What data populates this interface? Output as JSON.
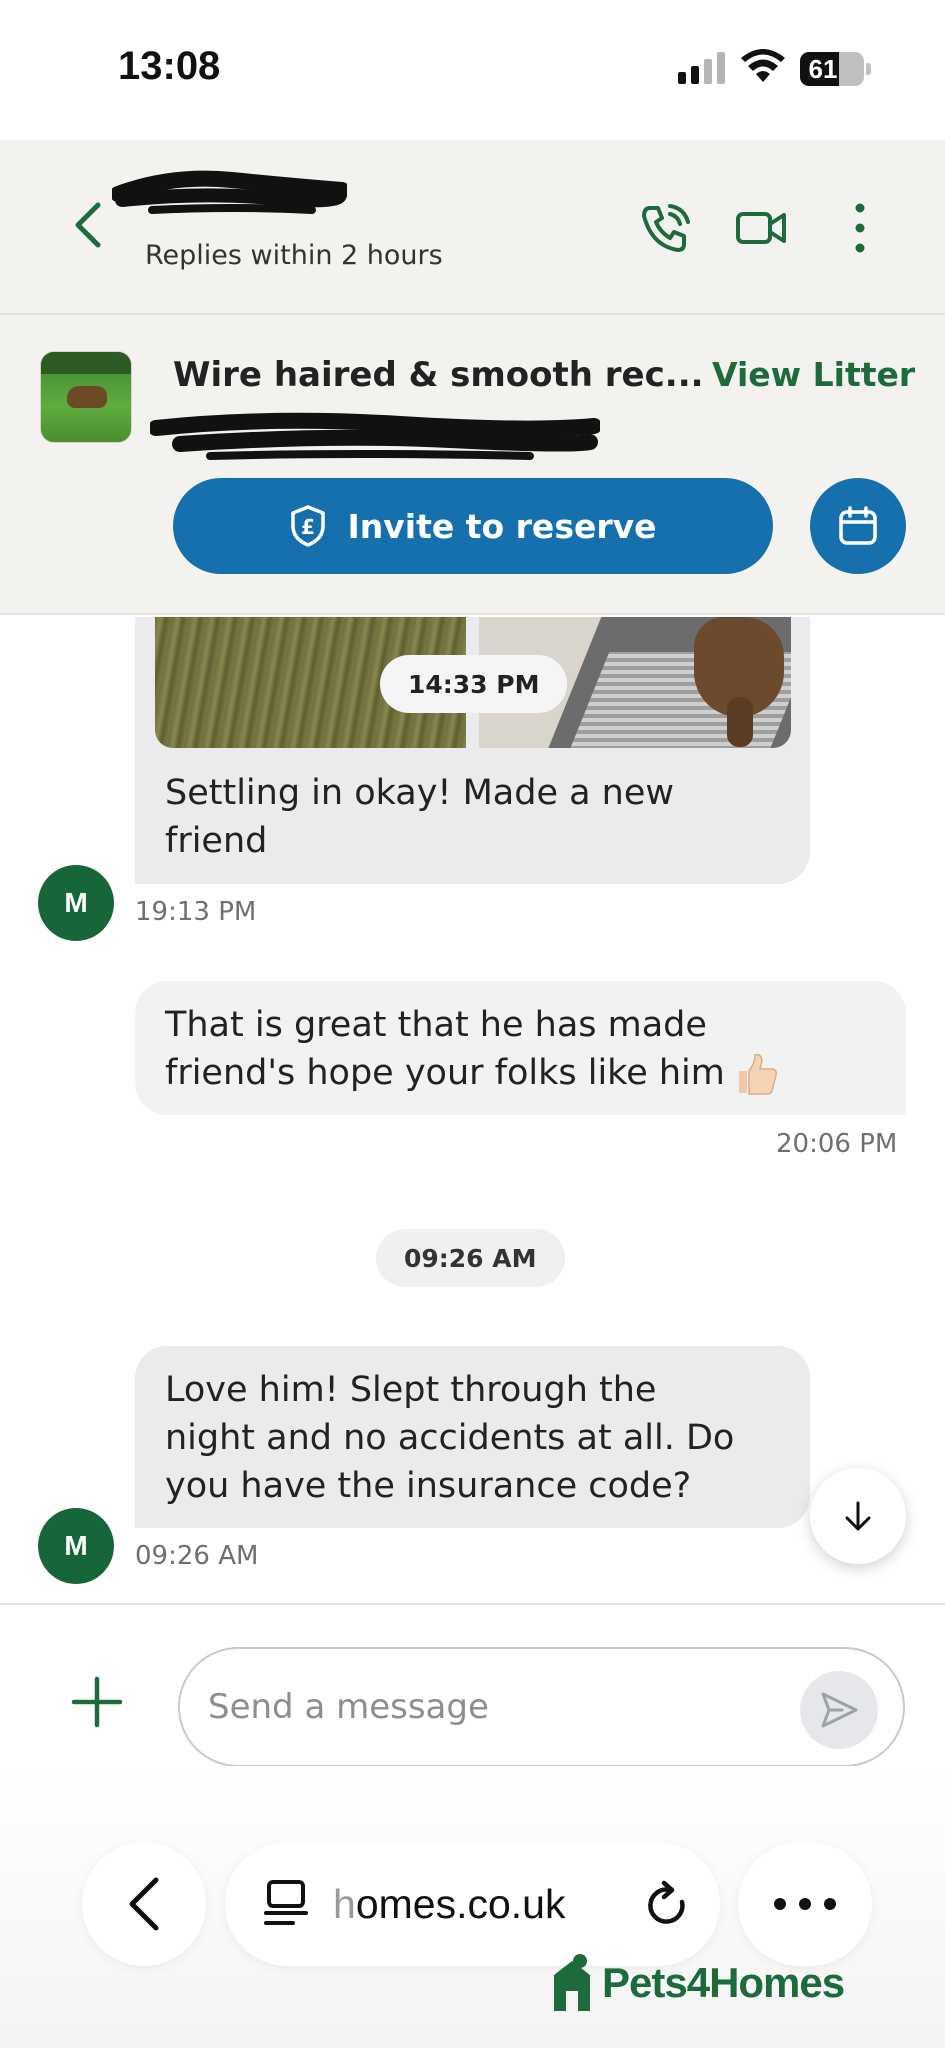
{
  "status_bar": {
    "time": "13:08",
    "battery": "61"
  },
  "header": {
    "name_redacted": "",
    "replies": "Replies within 2 hours"
  },
  "litter": {
    "title": "Wire haired & smooth rec...",
    "view_litter": "View Litter",
    "invite_label": "Invite to reserve"
  },
  "messages": [
    {
      "direction": "in",
      "image_time": "14:33 PM",
      "text_lines": [
        "Settling in okay! Made a new",
        "friend"
      ],
      "avatar": "M",
      "meta": "19:13 PM"
    },
    {
      "direction": "out",
      "text_lines": [
        "That is great that he has made",
        "friend's hope your folks like him"
      ],
      "meta": "20:06 PM"
    },
    {
      "direction": "in",
      "text_lines": [
        "Love him! Slept through the",
        "night and no accidents at all. Do",
        "you have the insurance code?"
      ],
      "avatar": "M",
      "meta": "09:26 AM"
    }
  ],
  "day_divider": "09:26 AM",
  "composer": {
    "placeholder": "Send a message"
  },
  "browser": {
    "url_prefix": "h",
    "url_rest": "omes.co.uk",
    "logo": "Pets4Homes"
  },
  "colors": {
    "brand_green": "#1d6b3a",
    "action_blue": "#1670ae",
    "avatar_green": "#16663a"
  }
}
